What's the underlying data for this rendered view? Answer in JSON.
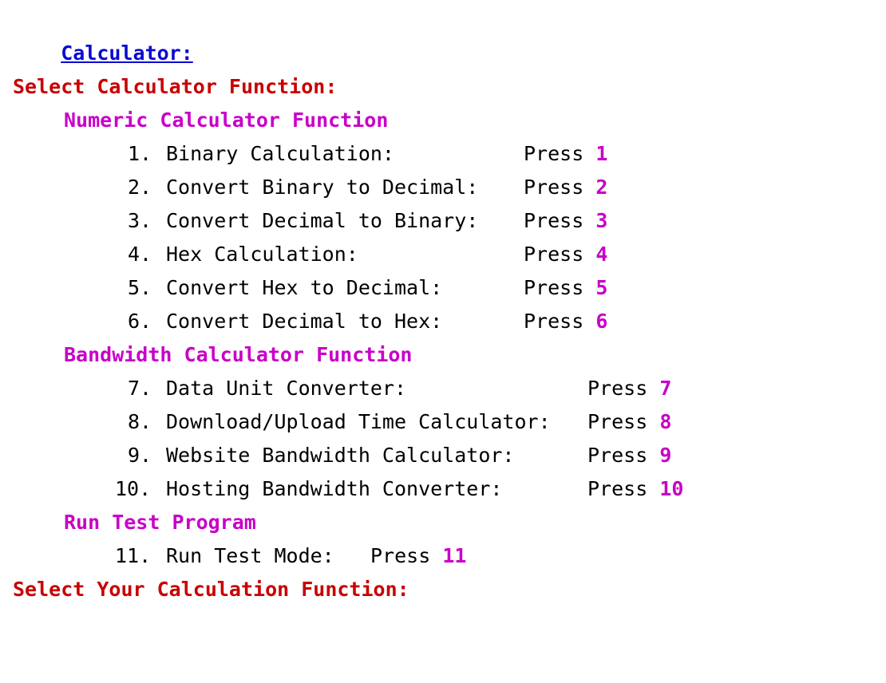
{
  "title": "Calculator:",
  "prompt_header": "Select Calculator Function:",
  "sections": [
    {
      "name": "Numeric Calculator Function",
      "items": [
        {
          "num": "1.",
          "label": "Binary Calculation:",
          "press": "Press",
          "key": "1"
        },
        {
          "num": "2.",
          "label": "Convert Binary to Decimal:",
          "press": "Press",
          "key": "2"
        },
        {
          "num": "3.",
          "label": "Convert Decimal to Binary:",
          "press": "Press",
          "key": "3"
        },
        {
          "num": "4.",
          "label": "Hex Calculation:",
          "press": "Press",
          "key": "4"
        },
        {
          "num": "5.",
          "label": "Convert Hex to Decimal:",
          "press": "Press",
          "key": "5"
        },
        {
          "num": "6.",
          "label": "Convert Decimal to Hex:",
          "press": "Press",
          "key": "6"
        }
      ]
    },
    {
      "name": "Bandwidth Calculator Function",
      "items": [
        {
          "num": "7.",
          "label": "Data Unit Converter:",
          "press": "Press",
          "key": "7"
        },
        {
          "num": "8.",
          "label": "Download/Upload Time Calculator:",
          "press": "Press",
          "key": "8"
        },
        {
          "num": "9.",
          "label": "Website Bandwidth Calculator:",
          "press": "Press",
          "key": "9"
        },
        {
          "num": "10.",
          "label": "Hosting Bandwidth Converter:",
          "press": "Press",
          "key": "10"
        }
      ]
    },
    {
      "name": "Run Test Program",
      "items": [
        {
          "num": "11.",
          "label": "Run Test Mode:",
          "press": "Press",
          "key": "11"
        }
      ]
    }
  ],
  "input_prompt": "Select Your Calculation Function:",
  "colors": {
    "title": "#0a0ad2",
    "prompt": "#c80000",
    "section": "#c800c8",
    "key": "#c800c8",
    "text": "#000000"
  }
}
